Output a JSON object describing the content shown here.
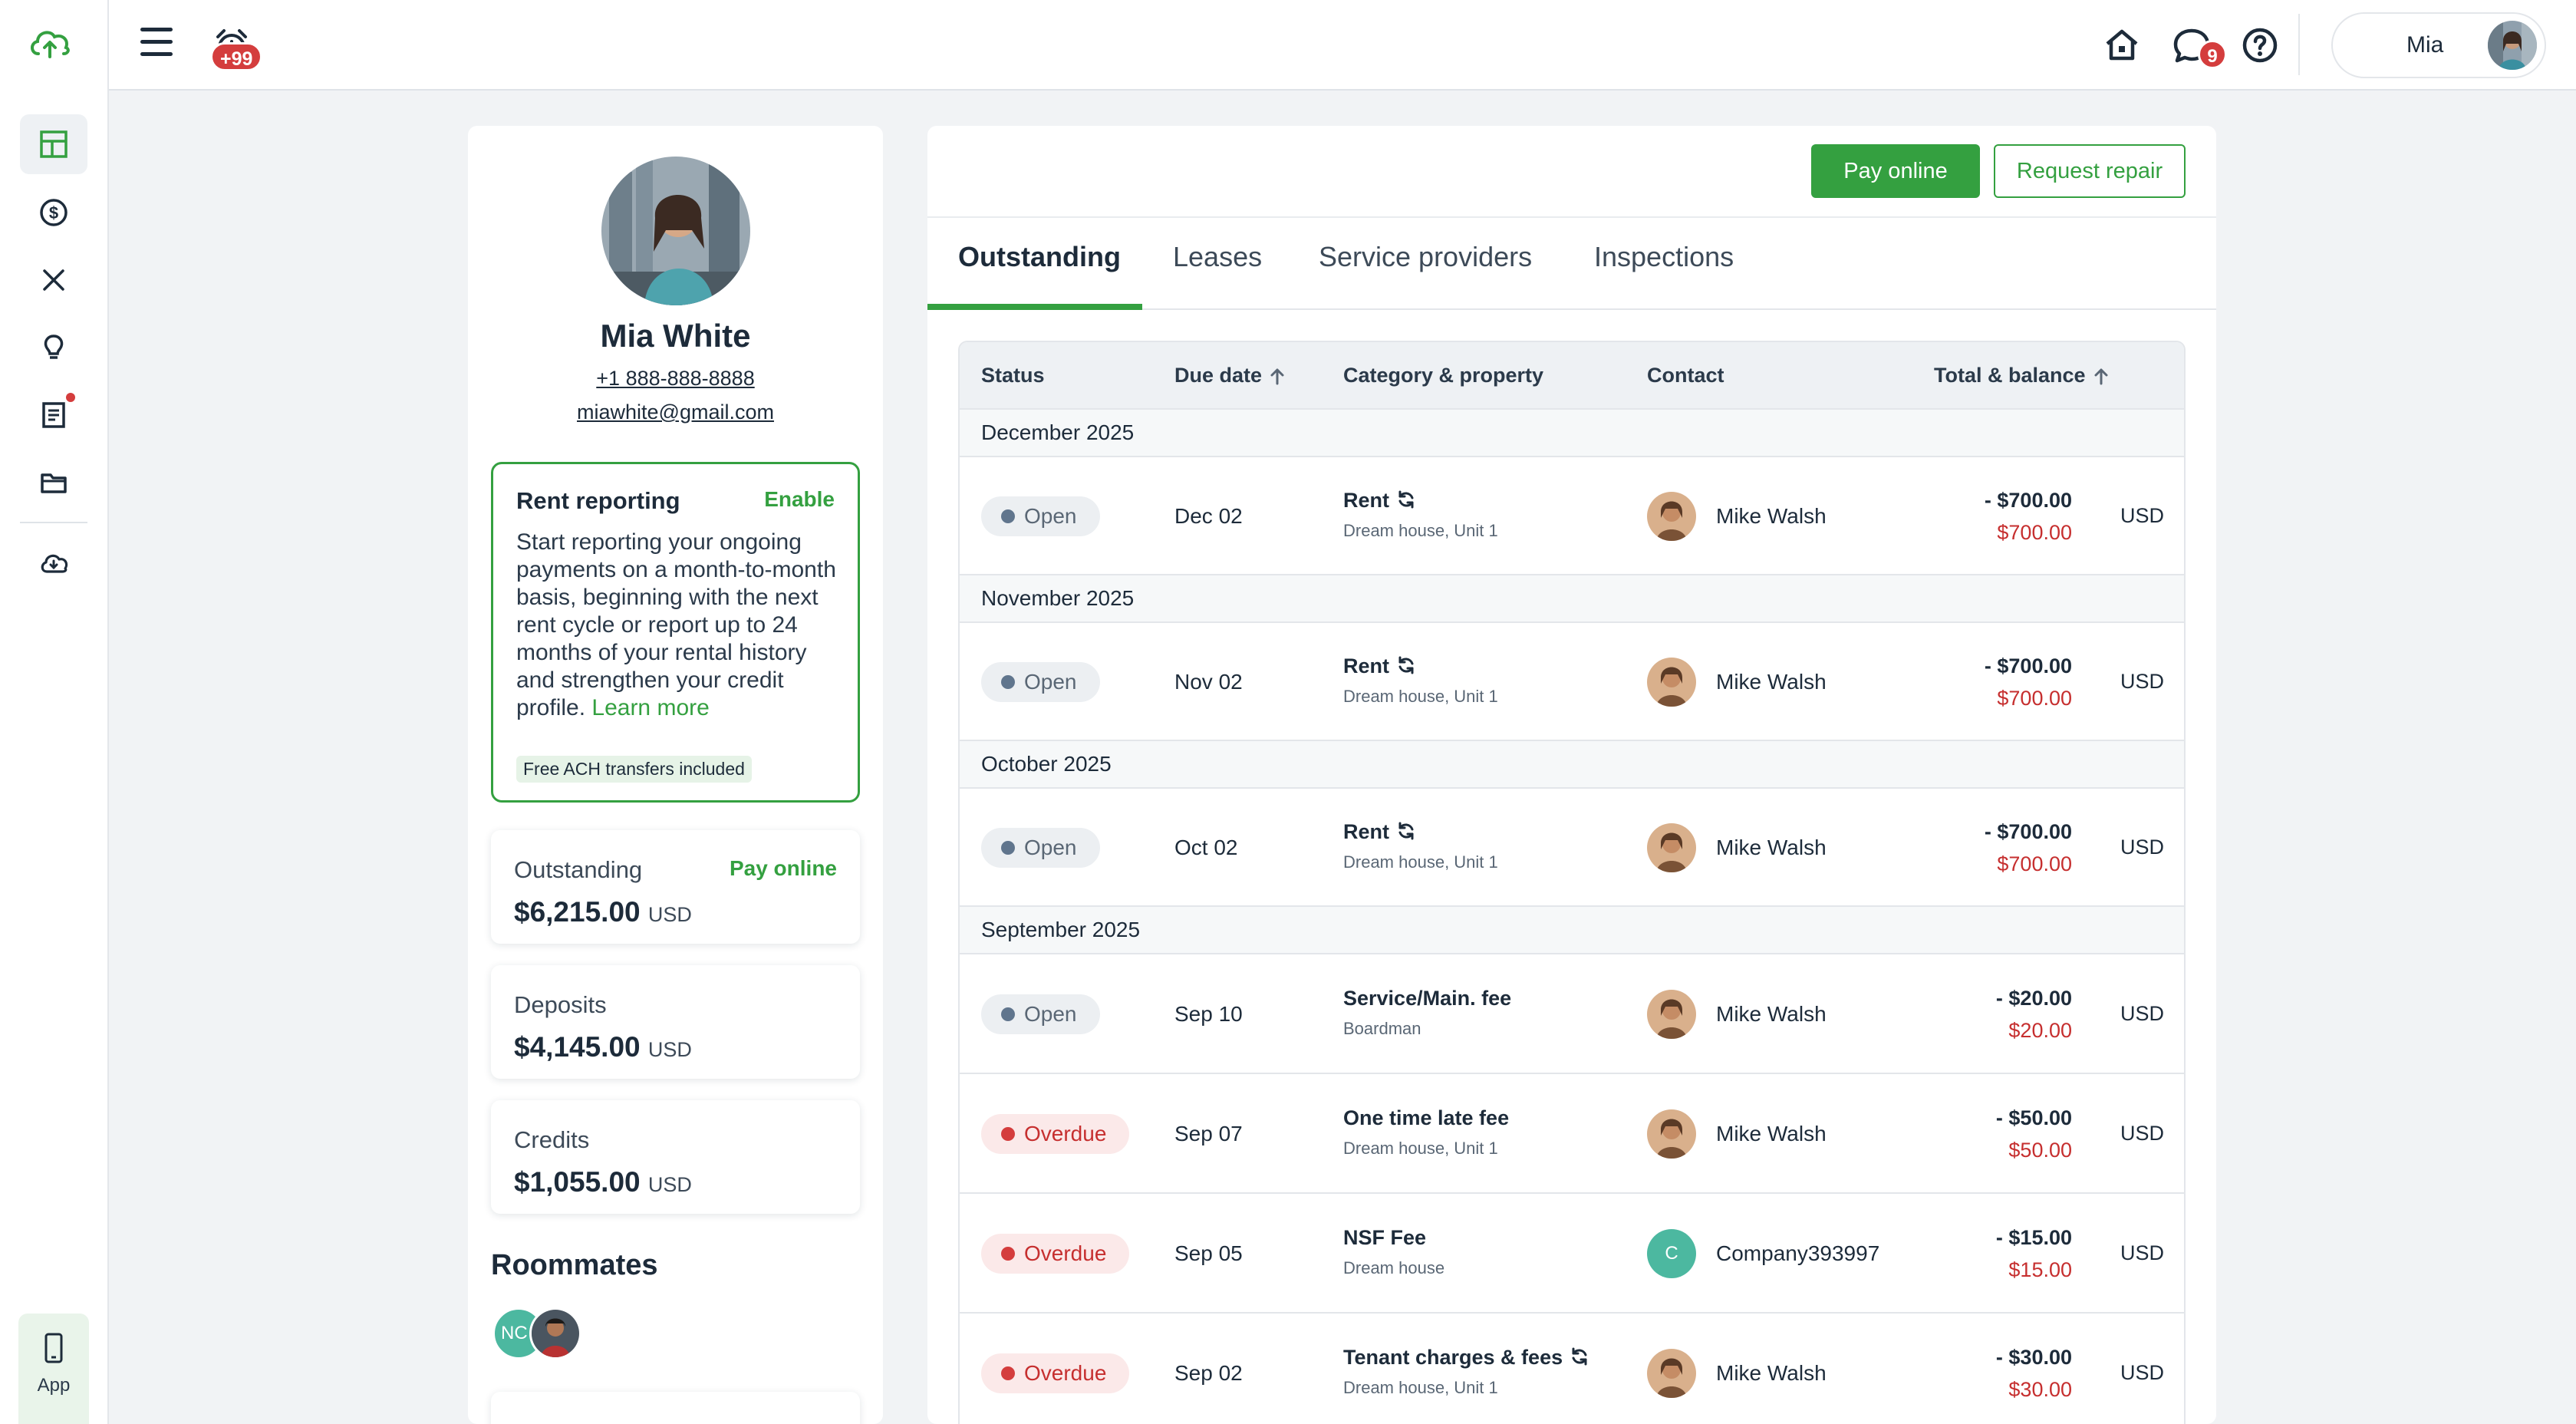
{
  "header": {
    "alert_badge": "+99",
    "messages_badge": "9",
    "user_name": "Mia"
  },
  "rail": {
    "app_label": "App"
  },
  "profile": {
    "name": "Mia White",
    "phone": "+1 888-888-8888",
    "email": "miawhite@gmail.com",
    "rent_reporting": {
      "title": "Rent reporting",
      "enable_label": "Enable",
      "body": "Start reporting your ongoing payments on a month-to-month basis, beginning with the next rent cycle or report up to 24 months of your rental history and strengthen your credit profile.",
      "learn_more": "Learn more",
      "chip": "Free ACH transfers included"
    },
    "outstanding": {
      "label": "Outstanding",
      "action": "Pay online",
      "value": "$6,215.00",
      "currency": "USD"
    },
    "deposits": {
      "label": "Deposits",
      "value": "$4,145.00",
      "currency": "USD"
    },
    "credits": {
      "label": "Credits",
      "value": "$1,055.00",
      "currency": "USD"
    },
    "roommates": {
      "title": "Roommates",
      "initials": "NC"
    }
  },
  "actions": {
    "pay_online": "Pay online",
    "request_repair": "Request repair"
  },
  "tabs": [
    {
      "label": "Outstanding",
      "active": true
    },
    {
      "label": "Leases",
      "active": false
    },
    {
      "label": "Service providers",
      "active": false
    },
    {
      "label": "Inspections",
      "active": false
    }
  ],
  "table": {
    "columns": [
      "Status",
      "Due date",
      "Category & property",
      "Contact",
      "Total & balance"
    ],
    "groups": [
      {
        "label": "December 2025",
        "rows": [
          {
            "status": "Open",
            "due": "Dec 02",
            "category": "Rent",
            "recurring": true,
            "property": "Dream house, Unit 1",
            "contact": "Mike Walsh",
            "total": "- $700.00",
            "balance": "$700.00",
            "currency": "USD"
          }
        ]
      },
      {
        "label": "November 2025",
        "rows": [
          {
            "status": "Open",
            "due": "Nov 02",
            "category": "Rent",
            "recurring": true,
            "property": "Dream house, Unit 1",
            "contact": "Mike Walsh",
            "total": "- $700.00",
            "balance": "$700.00",
            "currency": "USD"
          }
        ]
      },
      {
        "label": "October 2025",
        "rows": [
          {
            "status": "Open",
            "due": "Oct 02",
            "category": "Rent",
            "recurring": true,
            "property": "Dream house, Unit 1",
            "contact": "Mike Walsh",
            "total": "- $700.00",
            "balance": "$700.00",
            "currency": "USD"
          }
        ]
      },
      {
        "label": "September 2025",
        "rows": [
          {
            "status": "Open",
            "due": "Sep 10",
            "category": "Service/Main. fee",
            "recurring": false,
            "property": "Boardman",
            "contact": "Mike Walsh",
            "total": "- $20.00",
            "balance": "$20.00",
            "currency": "USD"
          },
          {
            "status": "Overdue",
            "due": "Sep 07",
            "category": "One time late fee",
            "recurring": false,
            "property": "Dream house, Unit 1",
            "contact": "Mike Walsh",
            "total": "- $50.00",
            "balance": "$50.00",
            "currency": "USD"
          },
          {
            "status": "Overdue",
            "due": "Sep 05",
            "category": "NSF Fee",
            "recurring": false,
            "property": "Dream house",
            "contact": "Company393997",
            "contact_initial": "C",
            "total": "- $15.00",
            "balance": "$15.00",
            "currency": "USD"
          },
          {
            "status": "Overdue",
            "due": "Sep 02",
            "category": "Tenant charges & fees",
            "recurring": true,
            "property": "Dream house, Unit 1",
            "contact": "Mike Walsh",
            "total": "- $30.00",
            "balance": "$30.00",
            "currency": "USD"
          }
        ]
      }
    ]
  }
}
